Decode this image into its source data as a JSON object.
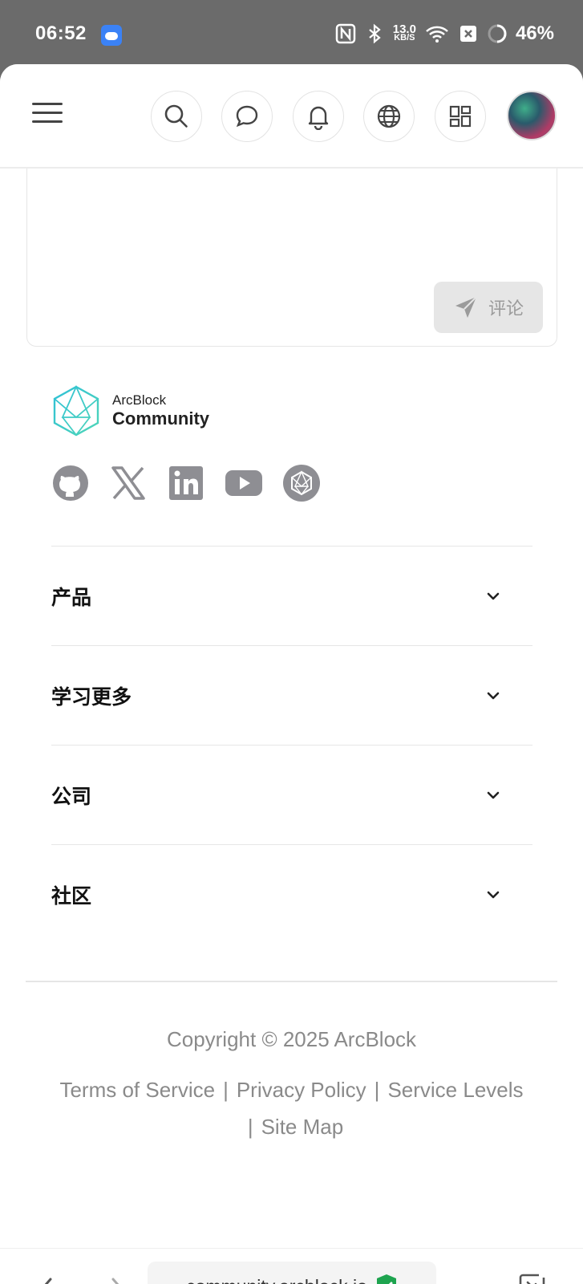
{
  "status_bar": {
    "time": "06:52",
    "speed_value": "13.0",
    "speed_unit": "KB/S",
    "battery": "46%"
  },
  "header": {
    "icons": [
      "menu-icon",
      "search-icon",
      "chat-icon",
      "bell-icon",
      "globe-icon",
      "apps-icon",
      "avatar"
    ]
  },
  "comment": {
    "submit_label": "评论"
  },
  "footer": {
    "logo_small": "ArcBlock",
    "logo_big": "Community",
    "socials": [
      "github-icon",
      "x-icon",
      "linkedin-icon",
      "youtube-icon",
      "arcblock-icon"
    ],
    "sections": [
      {
        "label": "产品"
      },
      {
        "label": "学习更多"
      },
      {
        "label": "公司"
      },
      {
        "label": "社区"
      }
    ],
    "copyright": "Copyright © 2025 ArcBlock",
    "links": {
      "terms": "Terms of Service",
      "privacy": "Privacy Policy",
      "service_levels": "Service Levels",
      "site_map": "Site Map",
      "separator": "|"
    }
  },
  "browser": {
    "url": "community.arcblock.io",
    "more": "···"
  },
  "colors": {
    "status_bar_bg": "#6b6b6b",
    "secure_shield": "#1ea44f",
    "social_gray": "#8e8e93"
  }
}
